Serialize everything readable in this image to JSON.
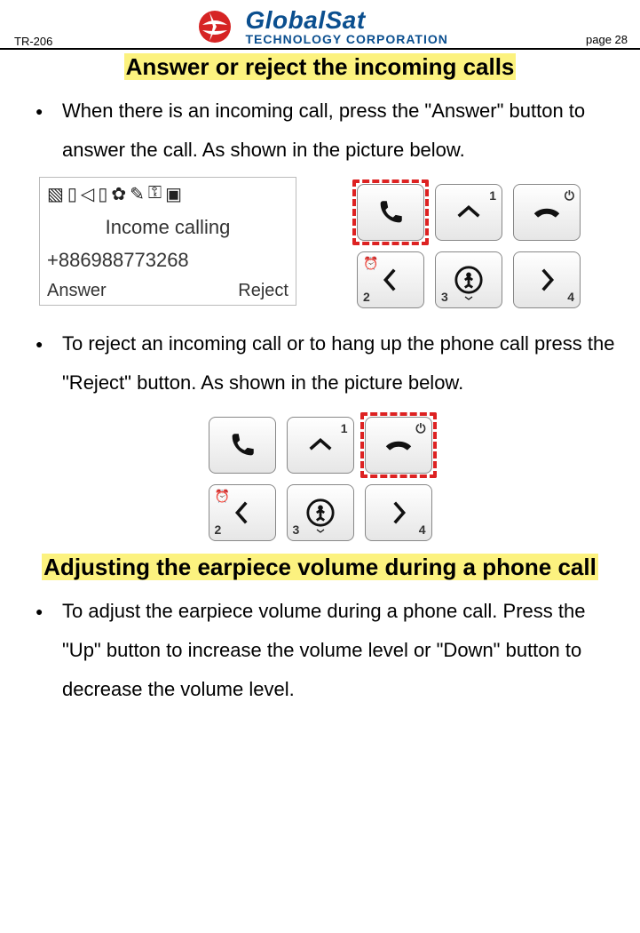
{
  "header": {
    "doc_id": "TR-206",
    "logo_top": "GlobalSat",
    "logo_bottom": "TECHNOLOGY CORPORATION",
    "page": "page 28"
  },
  "section1": {
    "title": "Answer or reject the incoming calls",
    "bullet1": "When there is an incoming call, press the \"Answer\" button to answer the call. As shown in the picture below.",
    "bullet2": "To reject an incoming call or to hang up the phone call press the \"Reject\" button. As shown in the picture below."
  },
  "phone_screen": {
    "line1": "Income calling",
    "line2": "+886988773268",
    "soft_left": "Answer",
    "soft_right": "Reject"
  },
  "keypad": {
    "k1": "1",
    "k2": "2",
    "k3": "3",
    "k4": "4"
  },
  "section2": {
    "title": "Adjusting the earpiece volume during a phone call",
    "bullet1": "To adjust the earpiece volume during a phone call. Press the \"Up\" button to increase the volume level or \"Down\" button to decrease the volume level."
  }
}
